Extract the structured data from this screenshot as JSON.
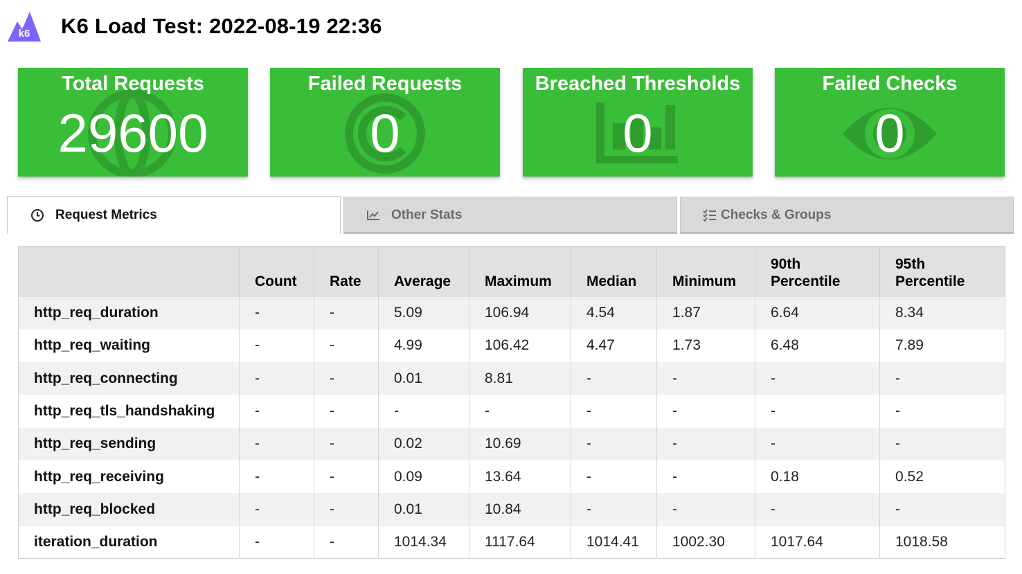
{
  "app": {
    "logo_text": "k6",
    "title": "K6 Load Test: 2022-08-19 22:36"
  },
  "colors": {
    "card_green": "#3abd39",
    "logo_purple": "#7d64ff",
    "header_bg": "#e1e1e1"
  },
  "cards": [
    {
      "title": "Total Requests",
      "value": "29600",
      "icon": "globe-icon"
    },
    {
      "title": "Failed Requests",
      "value": "0",
      "icon": "copyright-circle-icon"
    },
    {
      "title": "Breached Thresholds",
      "value": "0",
      "icon": "bar-chart-icon"
    },
    {
      "title": "Failed Checks",
      "value": "0",
      "icon": "eye-icon"
    }
  ],
  "tabs": [
    {
      "label": "Request Metrics",
      "icon": "clock-icon",
      "active": true
    },
    {
      "label": "Other Stats",
      "icon": "line-chart-icon",
      "active": false
    },
    {
      "label": "Checks & Groups",
      "icon": "checklist-icon",
      "active": false
    }
  ],
  "table": {
    "headers": [
      "",
      "Count",
      "Rate",
      "Average",
      "Maximum",
      "Median",
      "Minimum",
      "90th Percentile",
      "95th Percentile"
    ],
    "rows": [
      [
        "http_req_duration",
        "-",
        "-",
        "5.09",
        "106.94",
        "4.54",
        "1.87",
        "6.64",
        "8.34"
      ],
      [
        "http_req_waiting",
        "-",
        "-",
        "4.99",
        "106.42",
        "4.47",
        "1.73",
        "6.48",
        "7.89"
      ],
      [
        "http_req_connecting",
        "-",
        "-",
        "0.01",
        "8.81",
        "-",
        "-",
        "-",
        "-"
      ],
      [
        "http_req_tls_handshaking",
        "-",
        "-",
        "-",
        "-",
        "-",
        "-",
        "-",
        "-"
      ],
      [
        "http_req_sending",
        "-",
        "-",
        "0.02",
        "10.69",
        "-",
        "-",
        "-",
        "-"
      ],
      [
        "http_req_receiving",
        "-",
        "-",
        "0.09",
        "13.64",
        "-",
        "-",
        "0.18",
        "0.52"
      ],
      [
        "http_req_blocked",
        "-",
        "-",
        "0.01",
        "10.84",
        "-",
        "-",
        "-",
        "-"
      ],
      [
        "iteration_duration",
        "-",
        "-",
        "1014.34",
        "1117.64",
        "1014.41",
        "1002.30",
        "1017.64",
        "1018.58"
      ]
    ]
  }
}
